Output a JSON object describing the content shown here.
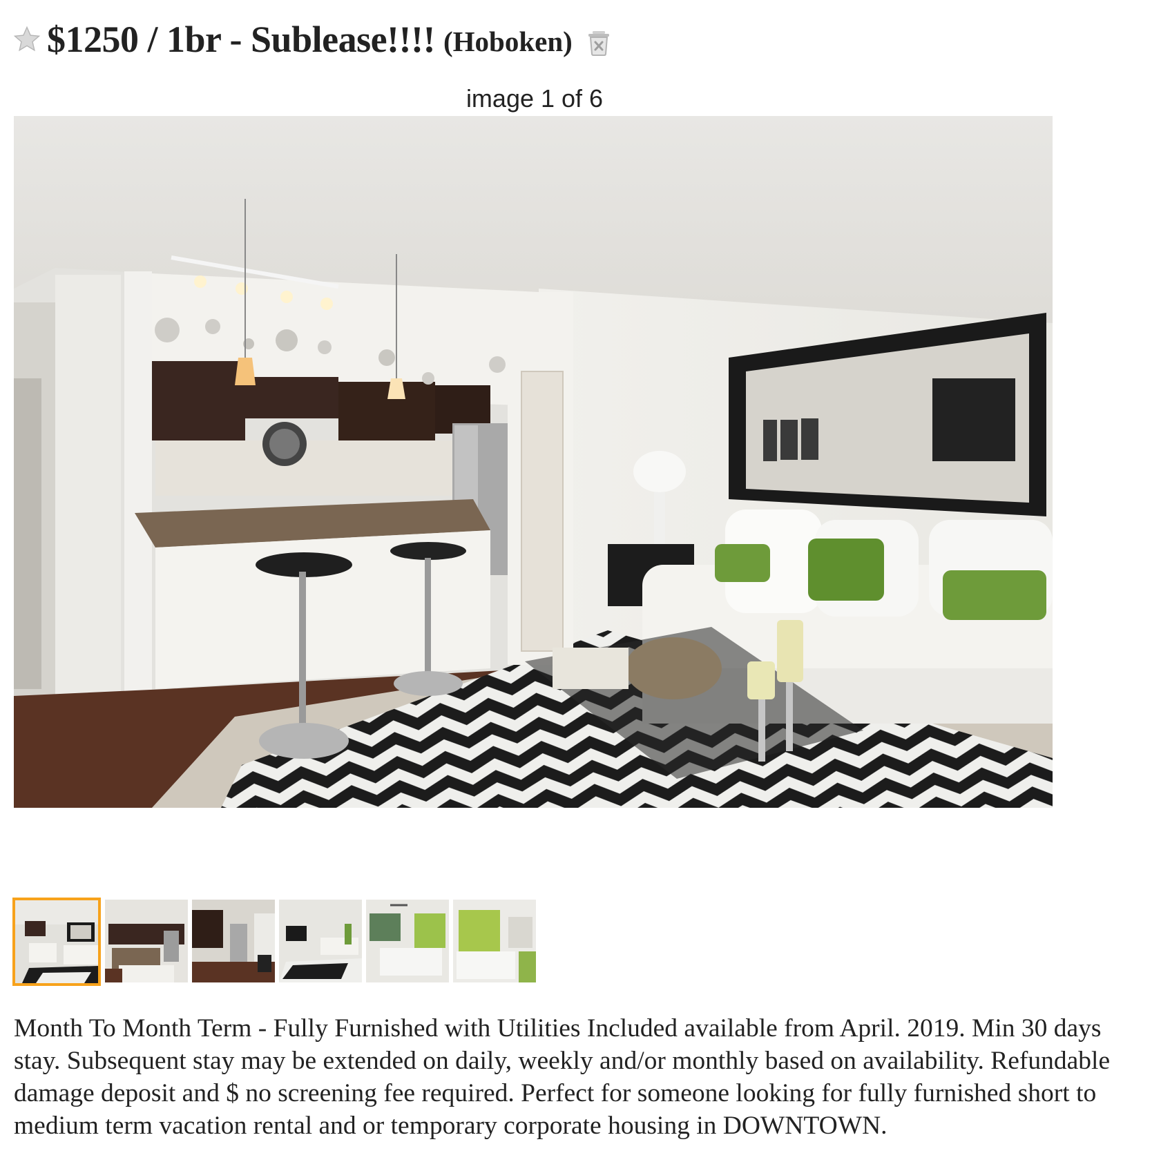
{
  "listing": {
    "title": "$1250 / 1br - Sublease!!!!",
    "location": "(Hoboken)"
  },
  "gallery": {
    "counter": "image 1 of 6",
    "selected_index": 1,
    "total": 6
  },
  "icons": {
    "favorite": "star-icon",
    "hide": "trash-x-icon"
  },
  "colors": {
    "thumb_highlight": "#f7a21b",
    "star": "#c8c8c8"
  },
  "description": "Month To Month Term - Fully Furnished with Utilities Included available from April. 2019. Min 30 days stay. Subsequent stay may be extended on daily, weekly and/or monthly based on availability. Refundable damage deposit and $ no screening fee required. Perfect for someone looking for fully furnished short to medium term vacation rental and or temporary corporate housing in DOWNTOWN."
}
